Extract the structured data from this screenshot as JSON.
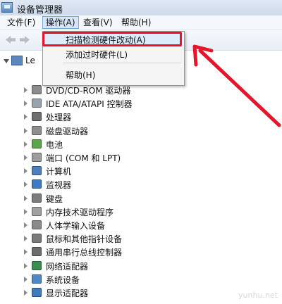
{
  "window": {
    "title": "设备管理器"
  },
  "menubar": {
    "items": [
      "文件(F)",
      "操作(A)",
      "查看(V)",
      "帮助(H)"
    ]
  },
  "dropdown": {
    "items": [
      "扫描检测硬件改动(A)",
      "添加过时硬件(L)",
      "帮助(H)"
    ],
    "highlighted_index": 0
  },
  "tree": {
    "root_label": "Le",
    "items": [
      {
        "label": "DVD/CD-ROM 驱动器",
        "icon": "dvd-drive-icon",
        "color": "#8c8c8c"
      },
      {
        "label": "IDE ATA/ATAPI 控制器",
        "icon": "ide-controller-icon",
        "color": "#9aa3ad"
      },
      {
        "label": "处理器",
        "icon": "processor-icon",
        "color": "#6f6f6f"
      },
      {
        "label": "磁盘驱动器",
        "icon": "disk-drive-icon",
        "color": "#8e8e8e"
      },
      {
        "label": "电池",
        "icon": "battery-icon",
        "color": "#5aa64b"
      },
      {
        "label": "端口 (COM 和 LPT)",
        "icon": "port-icon",
        "color": "#9c9c9c"
      },
      {
        "label": "计算机",
        "icon": "computer-icon",
        "color": "#4d7fc0"
      },
      {
        "label": "监视器",
        "icon": "monitor-icon",
        "color": "#3f79c4"
      },
      {
        "label": "键盘",
        "icon": "keyboard-icon",
        "color": "#7c7c7c"
      },
      {
        "label": "内存技术驱动程序",
        "icon": "memory-icon",
        "color": "#a0a0a0"
      },
      {
        "label": "人体学输入设备",
        "icon": "hid-icon",
        "color": "#8a8a8a"
      },
      {
        "label": "鼠标和其他指针设备",
        "icon": "mouse-icon",
        "color": "#7a7a7a"
      },
      {
        "label": "通用串行总线控制器",
        "icon": "usb-icon",
        "color": "#6d6d6d"
      },
      {
        "label": "网络适配器",
        "icon": "network-adapter-icon",
        "color": "#3b8c4f"
      },
      {
        "label": "系统设备",
        "icon": "system-device-icon",
        "color": "#4f86c6"
      },
      {
        "label": "显示适配器",
        "icon": "display-adapter-icon",
        "color": "#3d7bbd"
      }
    ]
  },
  "watermark": "yunhu.net",
  "colors": {
    "highlight_red": "#e5152b",
    "menu_active": "#d6e6f8"
  }
}
